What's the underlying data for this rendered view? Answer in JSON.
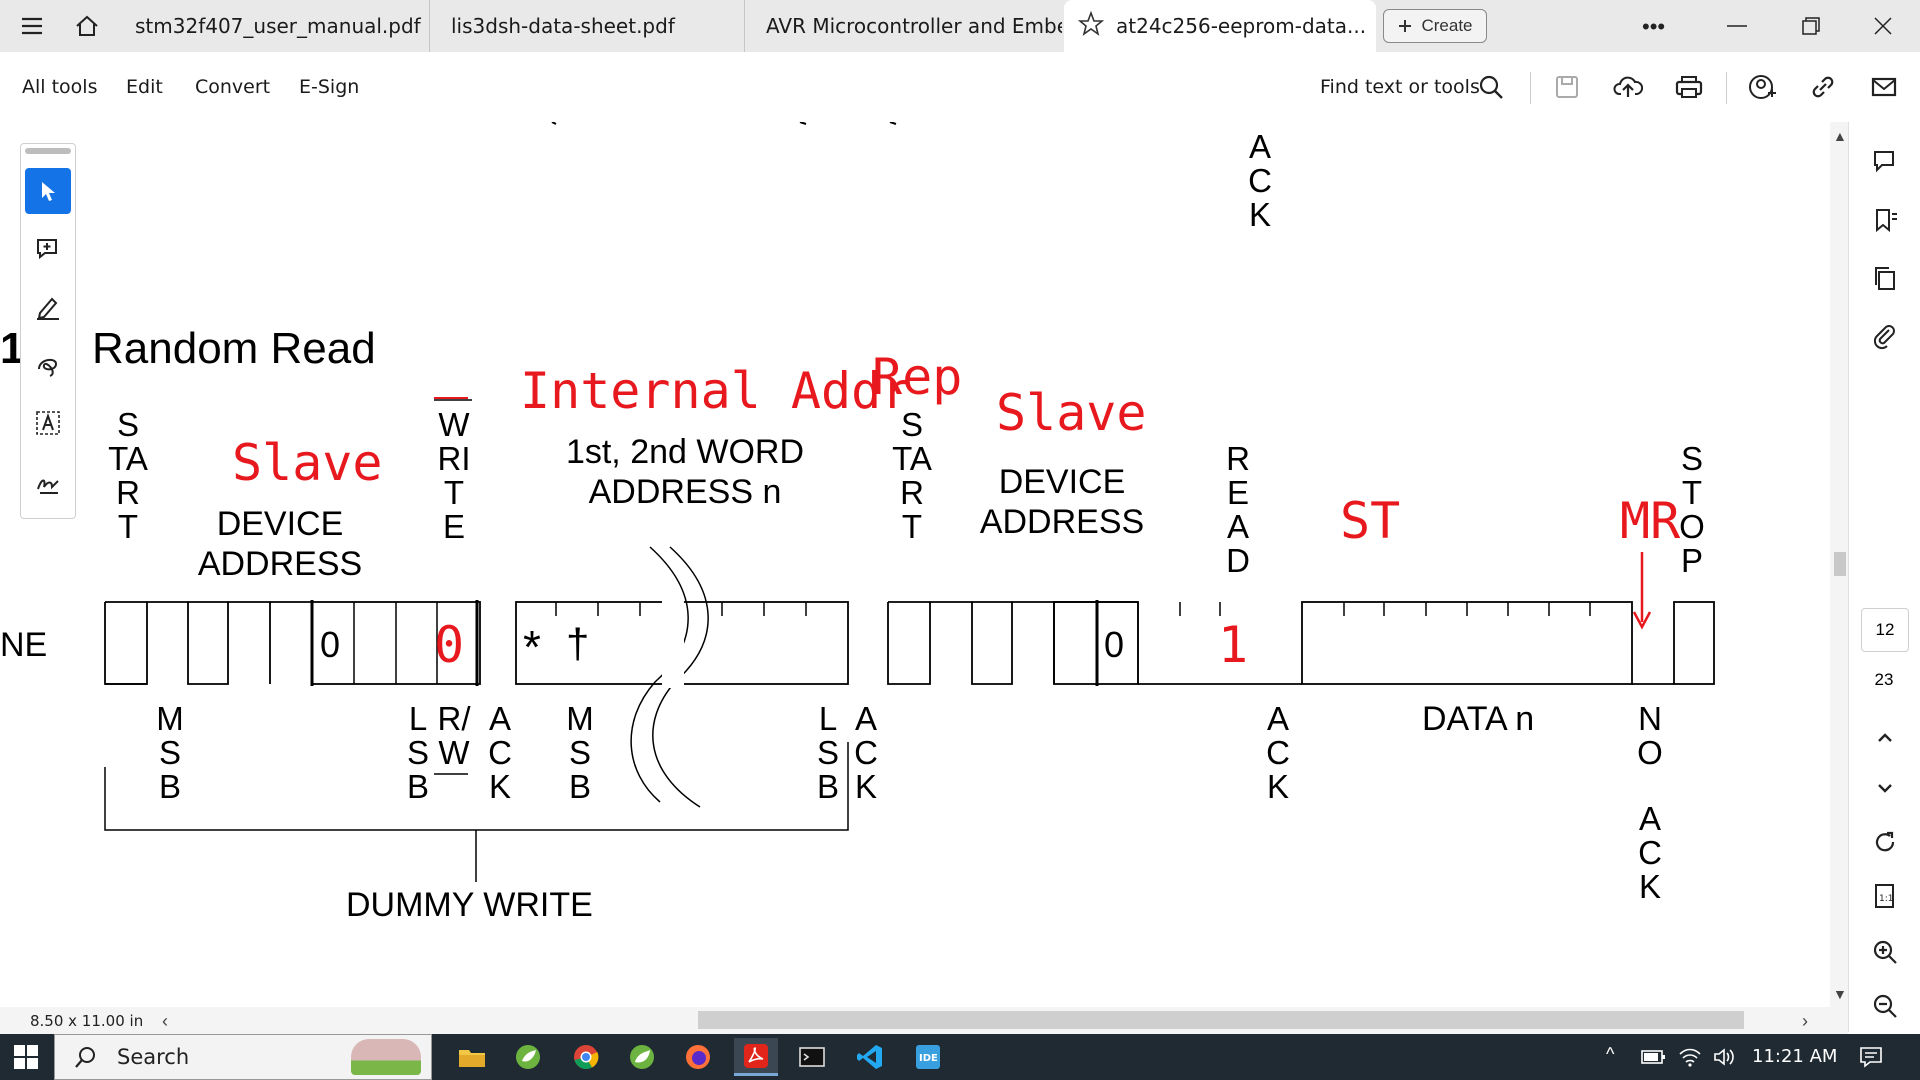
{
  "tabs": [
    {
      "label": "stm32f407_user_manual.pdf",
      "active": false
    },
    {
      "label": "lis3dsh-data-sheet.pdf",
      "active": false
    },
    {
      "label": "AVR Microcontroller and Embe...",
      "active": false
    },
    {
      "label": "at24c256-eeprom-data...",
      "active": true
    }
  ],
  "create_label": "Create",
  "menu": {
    "all_tools": "All tools",
    "edit": "Edit",
    "convert": "Convert",
    "esign": "E-Sign"
  },
  "find_label": "Find text or tools",
  "doc": {
    "section_num": "1",
    "section_title": "Random Read",
    "top_ack": "ACK",
    "start1": "START",
    "device_address1": [
      "DEVICE",
      "ADDRESS"
    ],
    "write": "WRITE",
    "word_address": [
      "1st, 2nd WORD",
      "ADDRESS n"
    ],
    "start2": "START",
    "device_address2": [
      "DEVICE",
      "ADDRESS"
    ],
    "read": "READ",
    "stop": "STOP",
    "line_label": "NE",
    "bit0_a": "0",
    "bit0_b": "0",
    "star": "*",
    "dagger": "†",
    "msb1": "MSB",
    "lsb1": "LSB",
    "rw": "R/W",
    "ack1": "ACK",
    "msb2": "MSB",
    "lsb2": "LSB",
    "ack2": "ACK",
    "ack3": "ACK",
    "data_n": "DATA n",
    "no": "NO",
    "no_ack": "ACK",
    "dummy_write": "DUMMY WRITE"
  },
  "annotations": {
    "slave1": "Slave",
    "internal_addr": "Internal Addr",
    "rep": "Rep",
    "slave2": "Slave",
    "st": "ST",
    "mr": "MR",
    "zero": "0",
    "one": "1"
  },
  "page_size": "8.50 x 11.00 in",
  "pages": {
    "current": "12",
    "total": "23"
  },
  "taskbar": {
    "search": "Search",
    "time": "11:21 AM"
  },
  "colors": {
    "annotation": "#e8191e",
    "taskbar": "#1f2a33",
    "accent": "#1473e6"
  }
}
